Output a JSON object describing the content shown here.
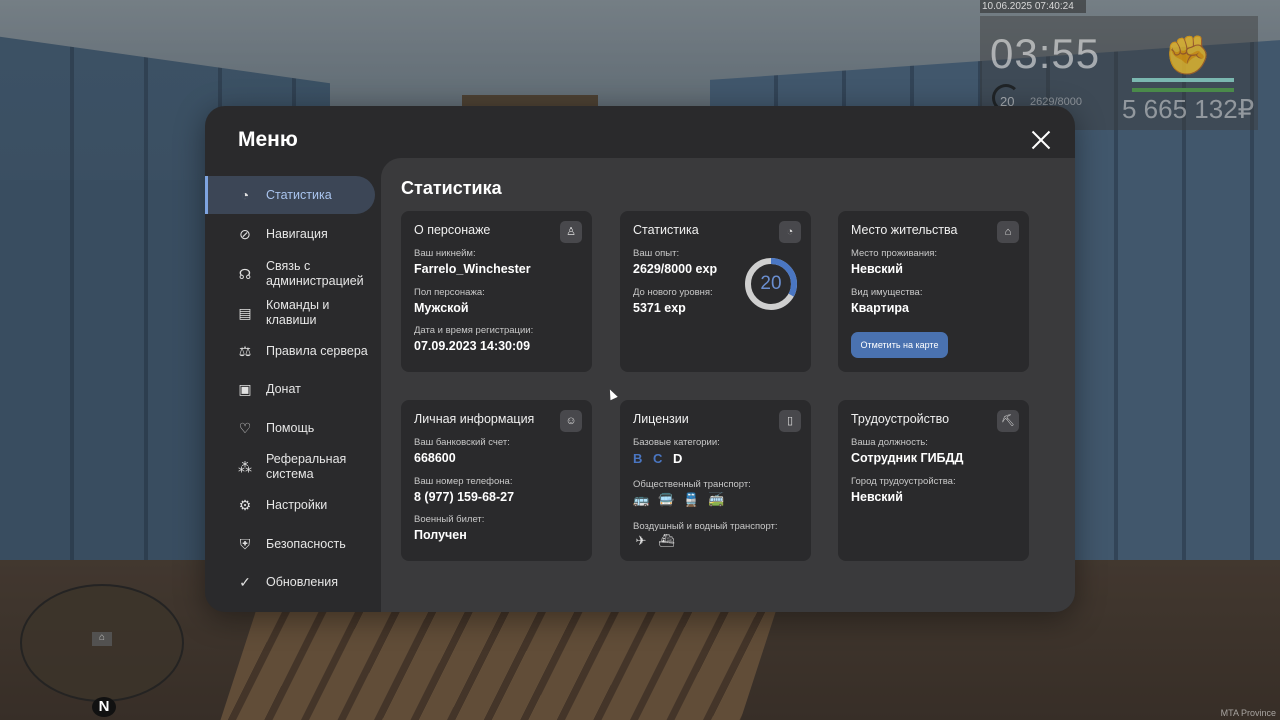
{
  "hud": {
    "datetime": "10.06.2025 07:40:24",
    "clock": "03:55",
    "level": "20",
    "exp": "2629/8000",
    "money": "5 665 132₽"
  },
  "watermark": "MTA Province",
  "compass": "N",
  "menu": {
    "title": "Меню",
    "close_icon": "close-icon"
  },
  "sidebar": {
    "items": [
      {
        "label": "Статистика",
        "icon": "◔",
        "active": true
      },
      {
        "label": "Навигация",
        "icon": "⊘"
      },
      {
        "label": "Связь с администрацией",
        "icon": "☊"
      },
      {
        "label": "Команды и клавиши",
        "icon": "▤"
      },
      {
        "label": "Правила сервера",
        "icon": "⚖"
      },
      {
        "label": "Донат",
        "icon": "▣"
      },
      {
        "label": "Помощь",
        "icon": "♡"
      },
      {
        "label": "Реферальная система",
        "icon": "⁂"
      },
      {
        "label": "Настройки",
        "icon": "⚙"
      },
      {
        "label": "Безопасность",
        "icon": "⛨"
      },
      {
        "label": "Обновления",
        "icon": "✓"
      }
    ]
  },
  "content": {
    "title": "Статистика",
    "about": {
      "title": "О персонаже",
      "icon": "♙",
      "nick_label": "Ваш никнейм:",
      "nick": "Farrelo_Winchester",
      "gender_label": "Пол персонажа:",
      "gender": "Мужской",
      "reg_label": "Дата и время регистрации:",
      "reg": "07.09.2023 14:30:09"
    },
    "stats": {
      "title": "Статистика",
      "icon": "◔",
      "exp_label": "Ваш опыт:",
      "exp": "2629/8000 exp",
      "next_label": "До нового уровня:",
      "next": "5371 exp",
      "level": "20",
      "progress": 0.33,
      "ring_color": "#4a76c2",
      "ring_track": "#cfcfcf"
    },
    "residence": {
      "title": "Место жительства",
      "icon": "⌂",
      "place_label": "Место проживания:",
      "place": "Невский",
      "type_label": "Вид имущества:",
      "type": "Квартира",
      "button": "Отметить на карте"
    },
    "personal": {
      "title": "Личная информация",
      "icon": "☺",
      "bank_label": "Ваш банковский счет:",
      "bank": "668600",
      "phone_label": "Ваш номер телефона:",
      "phone": "8 (977) 159-68-27",
      "military_label": "Военный билет:",
      "military": "Получен"
    },
    "licenses": {
      "title": "Лицензии",
      "icon": "▯",
      "base_label": "Базовые категории:",
      "categories": [
        "B",
        "C",
        "D"
      ],
      "public_label": "Общественный транспорт:",
      "public_icons": [
        "🚌",
        "🚍",
        "🚆",
        "🚎"
      ],
      "air_label": "Воздушный и водный транспорт:",
      "air_icons": [
        "✈",
        "⛴"
      ]
    },
    "job": {
      "title": "Трудоустройство",
      "icon": "⛏",
      "position_label": "Ваша должность:",
      "position": "Сотрудник ГИБДД",
      "city_label": "Город трудоустройства:",
      "city": "Невский"
    }
  }
}
